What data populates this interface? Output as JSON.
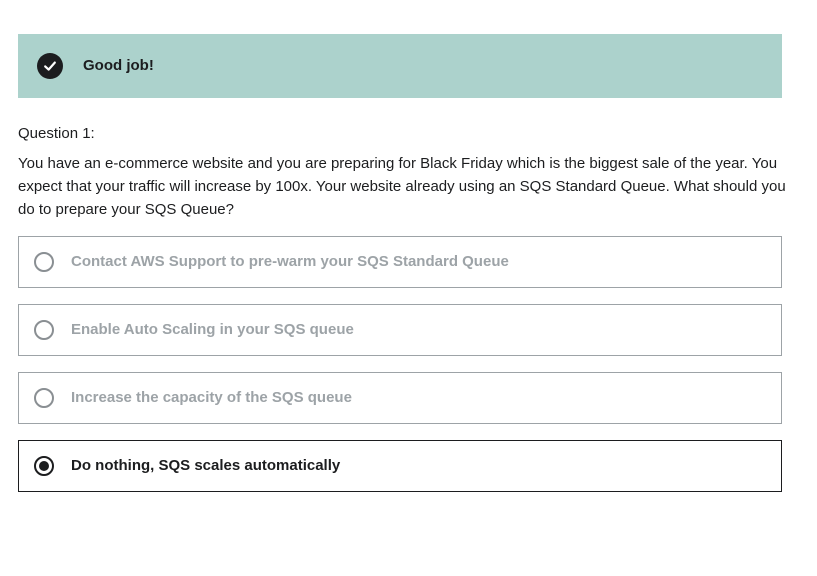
{
  "feedback": {
    "icon": "checkmark-icon",
    "message": "Good job!",
    "background_color": "#acd2cc"
  },
  "question": {
    "label": "Question 1:",
    "text": "You have an e-commerce website and you are preparing for Black Friday which is the biggest sale of the year. You expect that your traffic will increase by 100x. Your website already using an SQS Standard Queue. What should you do to prepare your SQS Queue?"
  },
  "options": [
    {
      "text": "Contact AWS Support to pre-warm your SQS Standard Queue",
      "selected": false
    },
    {
      "text": "Enable Auto Scaling in your SQS queue",
      "selected": false
    },
    {
      "text": "Increase the capacity of the SQS queue",
      "selected": false
    },
    {
      "text": "Do nothing, SQS scales automatically",
      "selected": true
    }
  ]
}
